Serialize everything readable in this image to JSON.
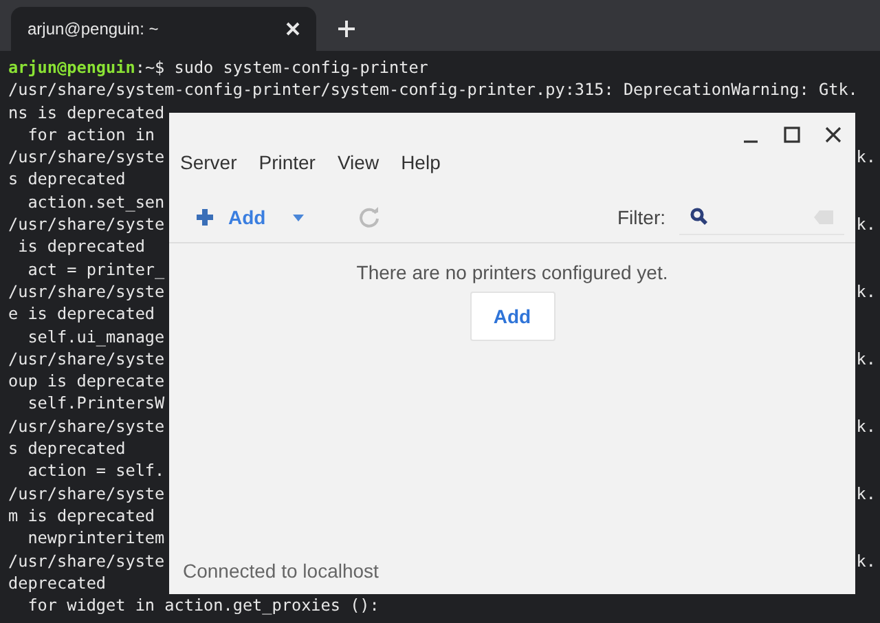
{
  "tabs": [
    {
      "title": "arjun@penguin: ~",
      "selected": true
    }
  ],
  "terminal": {
    "lines": [
      {
        "kind": "prompt",
        "user": "arjun@penguin",
        "rest": ":~$ sudo system-config-printer"
      },
      {
        "kind": "text",
        "left": "/usr/share/system-config-printer/system-config-printer.py:315: DeprecationWarning: Gtk."
      },
      {
        "kind": "text",
        "left": "ns is deprecated"
      },
      {
        "kind": "text",
        "left": "  for action in"
      },
      {
        "kind": "text",
        "left": "/usr/share/syste",
        "right": "k."
      },
      {
        "kind": "text",
        "left": "s deprecated"
      },
      {
        "kind": "text",
        "left": "  action.set_sen"
      },
      {
        "kind": "text",
        "left": "/usr/share/syste",
        "right": "k."
      },
      {
        "kind": "text",
        "left": " is deprecated"
      },
      {
        "kind": "text",
        "left": "  act = printer_"
      },
      {
        "kind": "text",
        "left": "/usr/share/syste",
        "right": "k."
      },
      {
        "kind": "text",
        "left": "e is deprecated"
      },
      {
        "kind": "text",
        "left": "  self.ui_manage"
      },
      {
        "kind": "text",
        "left": "/usr/share/syste",
        "right": "k."
      },
      {
        "kind": "text",
        "left": "oup is deprecate"
      },
      {
        "kind": "text",
        "left": "  self.PrintersW"
      },
      {
        "kind": "text",
        "left": "/usr/share/syste",
        "right": "k."
      },
      {
        "kind": "text",
        "left": "s deprecated"
      },
      {
        "kind": "text",
        "left": "  action = self."
      },
      {
        "kind": "text",
        "left": "/usr/share/syste",
        "right": "k."
      },
      {
        "kind": "text",
        "left": "m is deprecated"
      },
      {
        "kind": "text",
        "left": "  newprinteritem"
      },
      {
        "kind": "text",
        "left": "/usr/share/syste",
        "right": "k."
      },
      {
        "kind": "text",
        "left": "deprecated"
      },
      {
        "kind": "text",
        "left": "  for widget in action.get_proxies ():"
      }
    ]
  },
  "dialog": {
    "menu": [
      {
        "label": "Server"
      },
      {
        "label": "Printer"
      },
      {
        "label": "View"
      },
      {
        "label": "Help"
      }
    ],
    "toolbar": {
      "add_label": "Add",
      "filter_label": "Filter:"
    },
    "message": "There are no printers configured yet.",
    "add_button": "Add",
    "status_bar": "Connected to localhost"
  }
}
